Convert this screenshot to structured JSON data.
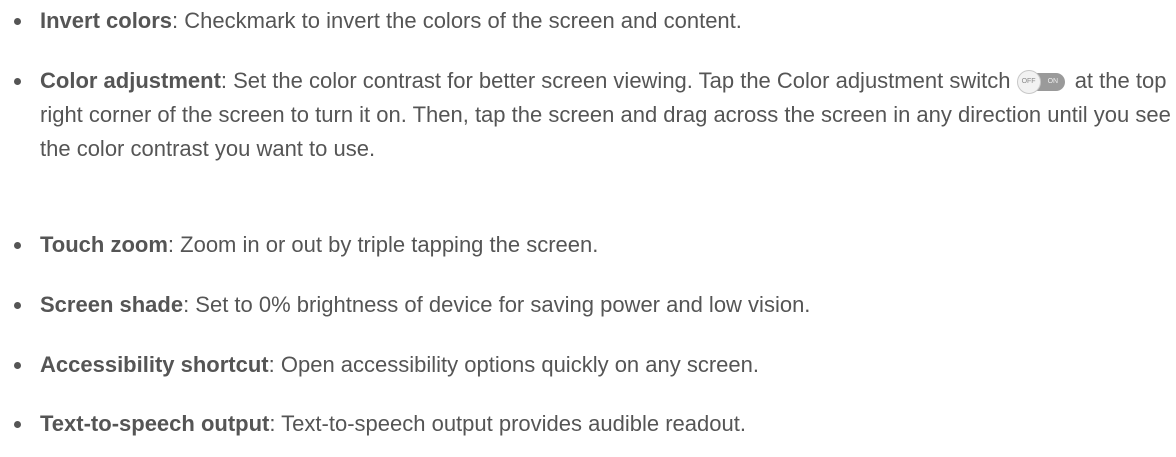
{
  "items": [
    {
      "term": "Invert colors",
      "text": ": Checkmark to invert the colors of the screen and content."
    },
    {
      "term": "Color adjustment",
      "text_before_switch": ": Set the color contrast for better screen viewing. Tap the Color adjustment switch",
      "switch": {
        "off_label": "OFF",
        "on_label": "ON",
        "icon": "toggle-switch-icon"
      },
      "text_after_switch": "at the top right corner of the screen to turn it on. Then, tap the screen and drag across the screen in any direction until you see the color contrast you want to use."
    },
    {
      "term": "Touch zoom",
      "text": ": Zoom in or out by triple tapping the screen."
    },
    {
      "term": "Screen shade",
      "text": ": Set to 0% brightness of device for saving power and low vision."
    },
    {
      "term": "Accessibility shortcut",
      "text": ": Open accessibility options quickly on any screen."
    },
    {
      "term": "Text-to-speech output",
      "text": ": Text-to-speech output provides audible readout."
    }
  ]
}
